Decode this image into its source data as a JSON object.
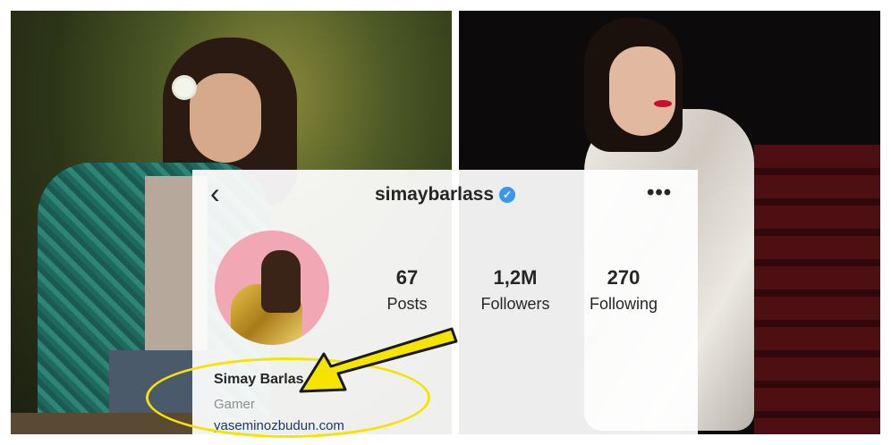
{
  "profile": {
    "username": "simaybarlass",
    "verified_icon": "verified-badge-icon",
    "back_icon": "back-chevron-icon",
    "more_icon": "more-options-icon",
    "avatar_icon": "profile-avatar-icon",
    "stats": [
      {
        "number": "67",
        "label": "Posts"
      },
      {
        "number": "1,2M",
        "label": "Followers"
      },
      {
        "number": "270",
        "label": "Following"
      }
    ],
    "name": "Simay Barlas",
    "category": "Gamer",
    "link": "yaseminozbudun.com"
  },
  "annotation": {
    "color": "#f4e400",
    "arrow_icon": "yellow-arrow-icon",
    "highlight_icon": "yellow-ellipse-highlight"
  },
  "colors": {
    "verified": "#3897f0",
    "text": "#262626",
    "secondary": "#8e8e8e"
  }
}
